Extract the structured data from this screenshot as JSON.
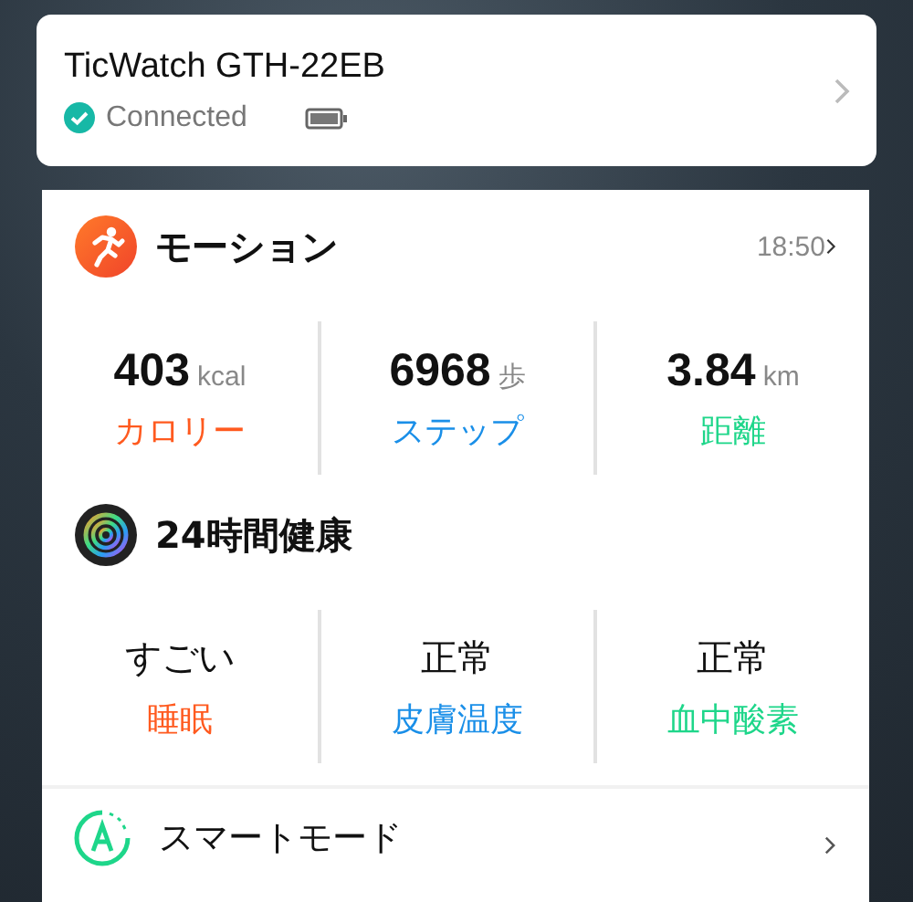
{
  "device": {
    "name": "TicWatch GTH-22EB",
    "status": "Connected",
    "connected": true
  },
  "motion": {
    "title": "モーション",
    "time": "18:50",
    "stats": [
      {
        "value": "403",
        "unit": "kcal",
        "label": "カロリー",
        "color": "#ff5a1f"
      },
      {
        "value": "6968",
        "unit": "歩",
        "label": "ステップ",
        "color": "#1a8fe8"
      },
      {
        "value": "3.84",
        "unit": "km",
        "label": "距離",
        "color": "#1ed68a"
      }
    ]
  },
  "health": {
    "title": "24時間健康",
    "stats": [
      {
        "value": "すごい",
        "label": "睡眠",
        "color": "#ff5a1f"
      },
      {
        "value": "正常",
        "label": "皮膚温度",
        "color": "#1a8fe8"
      },
      {
        "value": "正常",
        "label": "血中酸素",
        "color": "#1ed68a"
      }
    ]
  },
  "smart_mode": {
    "title": "スマートモード"
  }
}
